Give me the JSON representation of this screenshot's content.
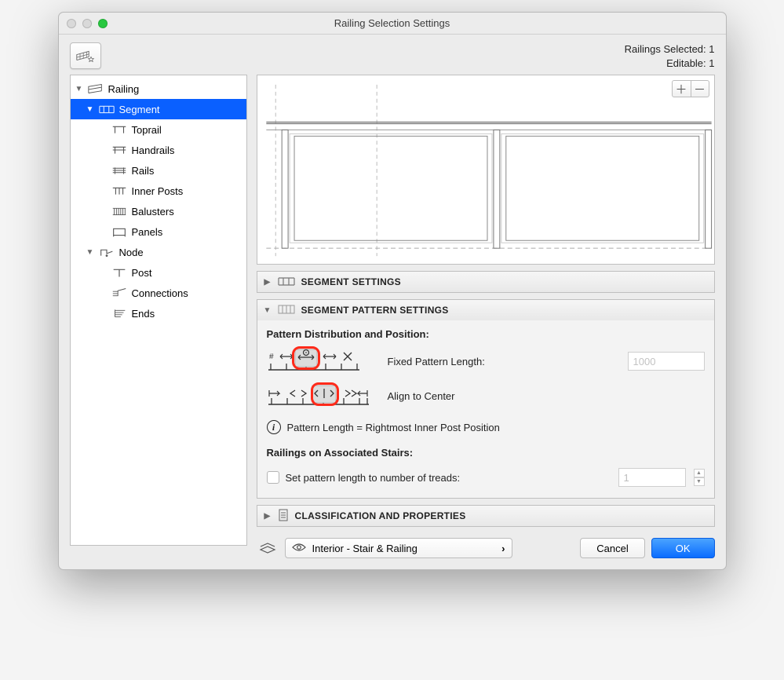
{
  "window": {
    "title": "Railing Selection Settings"
  },
  "header": {
    "selected_label": "Railings Selected: 1",
    "editable_label": "Editable: 1"
  },
  "tree": {
    "railing": "Railing",
    "segment": "Segment",
    "toprail": "Toprail",
    "handrails": "Handrails",
    "rails": "Rails",
    "inner_posts": "Inner Posts",
    "balusters": "Balusters",
    "panels": "Panels",
    "node": "Node",
    "post": "Post",
    "connections": "Connections",
    "ends": "Ends"
  },
  "sections": {
    "segment_settings": "SEGMENT SETTINGS",
    "segment_pattern": "SEGMENT PATTERN SETTINGS",
    "classification": "CLASSIFICATION AND PROPERTIES"
  },
  "pattern": {
    "heading": "Pattern Distribution and Position:",
    "fixed_label": "Fixed Pattern Length:",
    "fixed_value": "1000",
    "align_label": "Align to Center",
    "info": "Pattern Length = Rightmost Inner Post Position"
  },
  "stairs": {
    "heading": "Railings on Associated Stairs:",
    "check_label": "Set pattern length to number of treads:",
    "value": "1"
  },
  "footer": {
    "layer": "Interior - Stair & Railing",
    "cancel": "Cancel",
    "ok": "OK"
  }
}
